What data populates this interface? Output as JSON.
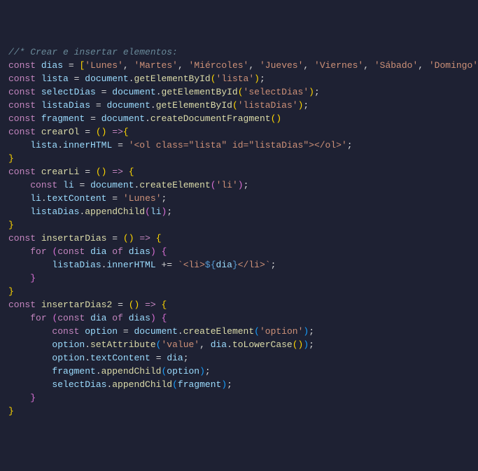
{
  "code": {
    "lines": [
      {
        "indent": 0,
        "t": [
          {
            "c": "comment",
            "v": "//* Crear e insertar elementos:"
          }
        ]
      },
      {
        "indent": 0,
        "t": [
          {
            "c": "kw",
            "v": "const"
          },
          {
            "c": "punct",
            "v": " "
          },
          {
            "c": "const-name",
            "v": "dias"
          },
          {
            "c": "punct",
            "v": " "
          },
          {
            "c": "op",
            "v": "="
          },
          {
            "c": "punct",
            "v": " "
          },
          {
            "c": "brace",
            "v": "["
          },
          {
            "c": "string",
            "v": "'Lunes'"
          },
          {
            "c": "punct",
            "v": ", "
          },
          {
            "c": "string",
            "v": "'Martes'"
          },
          {
            "c": "punct",
            "v": ", "
          },
          {
            "c": "string",
            "v": "'Miércoles'"
          },
          {
            "c": "punct",
            "v": ", "
          },
          {
            "c": "string",
            "v": "'Jueves'"
          },
          {
            "c": "punct",
            "v": ", "
          },
          {
            "c": "string",
            "v": "'Viernes'"
          },
          {
            "c": "punct",
            "v": ", "
          },
          {
            "c": "string",
            "v": "'Sábado'"
          },
          {
            "c": "punct",
            "v": ", "
          },
          {
            "c": "string",
            "v": "'Domingo'"
          },
          {
            "c": "brace",
            "v": "]"
          },
          {
            "c": "punct",
            "v": ";"
          }
        ]
      },
      {
        "indent": 0,
        "t": [
          {
            "c": "kw",
            "v": "const"
          },
          {
            "c": "punct",
            "v": " "
          },
          {
            "c": "const-name",
            "v": "lista"
          },
          {
            "c": "punct",
            "v": " "
          },
          {
            "c": "op",
            "v": "="
          },
          {
            "c": "punct",
            "v": " "
          },
          {
            "c": "obj",
            "v": "document"
          },
          {
            "c": "punct",
            "v": "."
          },
          {
            "c": "method",
            "v": "getElementById"
          },
          {
            "c": "brace",
            "v": "("
          },
          {
            "c": "string",
            "v": "'lista'"
          },
          {
            "c": "brace",
            "v": ")"
          },
          {
            "c": "punct",
            "v": ";"
          }
        ]
      },
      {
        "indent": 0,
        "t": [
          {
            "c": "kw",
            "v": "const"
          },
          {
            "c": "punct",
            "v": " "
          },
          {
            "c": "const-name",
            "v": "selectDias"
          },
          {
            "c": "punct",
            "v": " "
          },
          {
            "c": "op",
            "v": "="
          },
          {
            "c": "punct",
            "v": " "
          },
          {
            "c": "obj",
            "v": "document"
          },
          {
            "c": "punct",
            "v": "."
          },
          {
            "c": "method",
            "v": "getElementById"
          },
          {
            "c": "brace",
            "v": "("
          },
          {
            "c": "string",
            "v": "'selectDias'"
          },
          {
            "c": "brace",
            "v": ")"
          },
          {
            "c": "punct",
            "v": ";"
          }
        ]
      },
      {
        "indent": 0,
        "t": [
          {
            "c": "kw",
            "v": "const"
          },
          {
            "c": "punct",
            "v": " "
          },
          {
            "c": "const-name",
            "v": "listaDias"
          },
          {
            "c": "punct",
            "v": " "
          },
          {
            "c": "op",
            "v": "="
          },
          {
            "c": "punct",
            "v": " "
          },
          {
            "c": "obj",
            "v": "document"
          },
          {
            "c": "punct",
            "v": "."
          },
          {
            "c": "method",
            "v": "getElementById"
          },
          {
            "c": "brace",
            "v": "("
          },
          {
            "c": "string",
            "v": "'listaDias'"
          },
          {
            "c": "brace",
            "v": ")"
          },
          {
            "c": "punct",
            "v": ";"
          }
        ]
      },
      {
        "indent": 0,
        "t": [
          {
            "c": "kw",
            "v": "const"
          },
          {
            "c": "punct",
            "v": " "
          },
          {
            "c": "const-name",
            "v": "fragment"
          },
          {
            "c": "punct",
            "v": " "
          },
          {
            "c": "op",
            "v": "="
          },
          {
            "c": "punct",
            "v": " "
          },
          {
            "c": "obj",
            "v": "document"
          },
          {
            "c": "punct",
            "v": "."
          },
          {
            "c": "method",
            "v": "createDocumentFragment"
          },
          {
            "c": "brace",
            "v": "()"
          }
        ]
      },
      {
        "indent": 0,
        "t": []
      },
      {
        "indent": 0,
        "t": [
          {
            "c": "kw",
            "v": "const"
          },
          {
            "c": "punct",
            "v": " "
          },
          {
            "c": "func-name",
            "v": "crearOl"
          },
          {
            "c": "punct",
            "v": " "
          },
          {
            "c": "op",
            "v": "="
          },
          {
            "c": "punct",
            "v": " "
          },
          {
            "c": "brace",
            "v": "()"
          },
          {
            "c": "punct",
            "v": " "
          },
          {
            "c": "kw",
            "v": "=>"
          },
          {
            "c": "brace",
            "v": "{"
          }
        ]
      },
      {
        "indent": 1,
        "t": [
          {
            "c": "obj",
            "v": "lista"
          },
          {
            "c": "punct",
            "v": "."
          },
          {
            "c": "prop",
            "v": "innerHTML"
          },
          {
            "c": "punct",
            "v": " "
          },
          {
            "c": "op",
            "v": "="
          },
          {
            "c": "punct",
            "v": " "
          },
          {
            "c": "string",
            "v": "'<ol class=\"lista\" id=\"listaDias\"></ol>'"
          },
          {
            "c": "punct",
            "v": ";"
          }
        ]
      },
      {
        "indent": 0,
        "t": [
          {
            "c": "brace",
            "v": "}"
          }
        ]
      },
      {
        "indent": 0,
        "t": []
      },
      {
        "indent": 0,
        "t": [
          {
            "c": "kw",
            "v": "const"
          },
          {
            "c": "punct",
            "v": " "
          },
          {
            "c": "func-name",
            "v": "crearLi"
          },
          {
            "c": "punct",
            "v": " "
          },
          {
            "c": "op",
            "v": "="
          },
          {
            "c": "punct",
            "v": " "
          },
          {
            "c": "brace",
            "v": "()"
          },
          {
            "c": "punct",
            "v": " "
          },
          {
            "c": "kw",
            "v": "=>"
          },
          {
            "c": "punct",
            "v": " "
          },
          {
            "c": "brace",
            "v": "{"
          }
        ]
      },
      {
        "indent": 1,
        "t": [
          {
            "c": "kw",
            "v": "const"
          },
          {
            "c": "punct",
            "v": " "
          },
          {
            "c": "const-name",
            "v": "li"
          },
          {
            "c": "punct",
            "v": " "
          },
          {
            "c": "op",
            "v": "="
          },
          {
            "c": "punct",
            "v": " "
          },
          {
            "c": "obj",
            "v": "document"
          },
          {
            "c": "punct",
            "v": "."
          },
          {
            "c": "method",
            "v": "createElement"
          },
          {
            "c": "brace2",
            "v": "("
          },
          {
            "c": "string",
            "v": "'li'"
          },
          {
            "c": "brace2",
            "v": ")"
          },
          {
            "c": "punct",
            "v": ";"
          }
        ]
      },
      {
        "indent": 1,
        "t": [
          {
            "c": "obj",
            "v": "li"
          },
          {
            "c": "punct",
            "v": "."
          },
          {
            "c": "prop",
            "v": "textContent"
          },
          {
            "c": "punct",
            "v": " "
          },
          {
            "c": "op",
            "v": "="
          },
          {
            "c": "punct",
            "v": " "
          },
          {
            "c": "string",
            "v": "'Lunes'"
          },
          {
            "c": "punct",
            "v": ";"
          }
        ]
      },
      {
        "indent": 1,
        "t": [
          {
            "c": "obj",
            "v": "listaDias"
          },
          {
            "c": "punct",
            "v": "."
          },
          {
            "c": "method",
            "v": "appendChild"
          },
          {
            "c": "brace2",
            "v": "("
          },
          {
            "c": "obj",
            "v": "li"
          },
          {
            "c": "brace2",
            "v": ")"
          },
          {
            "c": "punct",
            "v": ";"
          }
        ]
      },
      {
        "indent": 0,
        "t": [
          {
            "c": "brace",
            "v": "}"
          }
        ]
      },
      {
        "indent": 0,
        "t": []
      },
      {
        "indent": 0,
        "t": [
          {
            "c": "kw",
            "v": "const"
          },
          {
            "c": "punct",
            "v": " "
          },
          {
            "c": "func-name",
            "v": "insertarDias"
          },
          {
            "c": "punct",
            "v": " "
          },
          {
            "c": "op",
            "v": "="
          },
          {
            "c": "punct",
            "v": " "
          },
          {
            "c": "brace",
            "v": "()"
          },
          {
            "c": "punct",
            "v": " "
          },
          {
            "c": "kw",
            "v": "=>"
          },
          {
            "c": "punct",
            "v": " "
          },
          {
            "c": "brace",
            "v": "{"
          }
        ]
      },
      {
        "indent": 1,
        "t": [
          {
            "c": "kw",
            "v": "for"
          },
          {
            "c": "punct",
            "v": " "
          },
          {
            "c": "brace2",
            "v": "("
          },
          {
            "c": "kw",
            "v": "const"
          },
          {
            "c": "punct",
            "v": " "
          },
          {
            "c": "const-name",
            "v": "dia"
          },
          {
            "c": "punct",
            "v": " "
          },
          {
            "c": "kw",
            "v": "of"
          },
          {
            "c": "punct",
            "v": " "
          },
          {
            "c": "obj",
            "v": "dias"
          },
          {
            "c": "brace2",
            "v": ")"
          },
          {
            "c": "punct",
            "v": " "
          },
          {
            "c": "brace2",
            "v": "{"
          }
        ]
      },
      {
        "indent": 2,
        "t": [
          {
            "c": "obj",
            "v": "listaDias"
          },
          {
            "c": "punct",
            "v": "."
          },
          {
            "c": "prop",
            "v": "innerHTML"
          },
          {
            "c": "punct",
            "v": " "
          },
          {
            "c": "op",
            "v": "+="
          },
          {
            "c": "punct",
            "v": " "
          },
          {
            "c": "string",
            "v": "`<li>"
          },
          {
            "c": "tpl-expr",
            "v": "${"
          },
          {
            "c": "obj",
            "v": "dia"
          },
          {
            "c": "tpl-expr",
            "v": "}"
          },
          {
            "c": "string",
            "v": "</li>`"
          },
          {
            "c": "punct",
            "v": ";"
          }
        ]
      },
      {
        "indent": 1,
        "t": [
          {
            "c": "brace2",
            "v": "}"
          }
        ]
      },
      {
        "indent": 0,
        "t": [
          {
            "c": "brace",
            "v": "}"
          }
        ]
      },
      {
        "indent": 0,
        "t": []
      },
      {
        "indent": 0,
        "t": [
          {
            "c": "kw",
            "v": "const"
          },
          {
            "c": "punct",
            "v": " "
          },
          {
            "c": "func-name",
            "v": "insertarDias2"
          },
          {
            "c": "punct",
            "v": " "
          },
          {
            "c": "op",
            "v": "="
          },
          {
            "c": "punct",
            "v": " "
          },
          {
            "c": "brace",
            "v": "()"
          },
          {
            "c": "punct",
            "v": " "
          },
          {
            "c": "kw",
            "v": "=>"
          },
          {
            "c": "punct",
            "v": " "
          },
          {
            "c": "brace",
            "v": "{"
          }
        ]
      },
      {
        "indent": 1,
        "t": [
          {
            "c": "kw",
            "v": "for"
          },
          {
            "c": "punct",
            "v": " "
          },
          {
            "c": "brace2",
            "v": "("
          },
          {
            "c": "kw",
            "v": "const"
          },
          {
            "c": "punct",
            "v": " "
          },
          {
            "c": "const-name",
            "v": "dia"
          },
          {
            "c": "punct",
            "v": " "
          },
          {
            "c": "kw",
            "v": "of"
          },
          {
            "c": "punct",
            "v": " "
          },
          {
            "c": "obj",
            "v": "dias"
          },
          {
            "c": "brace2",
            "v": ")"
          },
          {
            "c": "punct",
            "v": " "
          },
          {
            "c": "brace2",
            "v": "{"
          }
        ]
      },
      {
        "indent": 2,
        "t": [
          {
            "c": "kw",
            "v": "const"
          },
          {
            "c": "punct",
            "v": " "
          },
          {
            "c": "const-name",
            "v": "option"
          },
          {
            "c": "punct",
            "v": " "
          },
          {
            "c": "op",
            "v": "="
          },
          {
            "c": "punct",
            "v": " "
          },
          {
            "c": "obj",
            "v": "document"
          },
          {
            "c": "punct",
            "v": "."
          },
          {
            "c": "method",
            "v": "createElement"
          },
          {
            "c": "brace3",
            "v": "("
          },
          {
            "c": "string",
            "v": "'option'"
          },
          {
            "c": "brace3",
            "v": ")"
          },
          {
            "c": "punct",
            "v": ";"
          }
        ]
      },
      {
        "indent": 2,
        "t": [
          {
            "c": "obj",
            "v": "option"
          },
          {
            "c": "punct",
            "v": "."
          },
          {
            "c": "method",
            "v": "setAttribute"
          },
          {
            "c": "brace3",
            "v": "("
          },
          {
            "c": "string",
            "v": "'value'"
          },
          {
            "c": "punct",
            "v": ", "
          },
          {
            "c": "obj",
            "v": "dia"
          },
          {
            "c": "punct",
            "v": "."
          },
          {
            "c": "method",
            "v": "toLowerCase"
          },
          {
            "c": "brace",
            "v": "()"
          },
          {
            "c": "brace3",
            "v": ")"
          },
          {
            "c": "punct",
            "v": ";"
          }
        ]
      },
      {
        "indent": 2,
        "t": [
          {
            "c": "obj",
            "v": "option"
          },
          {
            "c": "punct",
            "v": "."
          },
          {
            "c": "prop",
            "v": "textContent"
          },
          {
            "c": "punct",
            "v": " "
          },
          {
            "c": "op",
            "v": "="
          },
          {
            "c": "punct",
            "v": " "
          },
          {
            "c": "obj",
            "v": "dia"
          },
          {
            "c": "punct",
            "v": ";"
          }
        ]
      },
      {
        "indent": 2,
        "t": [
          {
            "c": "obj",
            "v": "fragment"
          },
          {
            "c": "punct",
            "v": "."
          },
          {
            "c": "method",
            "v": "appendChild"
          },
          {
            "c": "brace3",
            "v": "("
          },
          {
            "c": "obj",
            "v": "option"
          },
          {
            "c": "brace3",
            "v": ")"
          },
          {
            "c": "punct",
            "v": ";"
          }
        ]
      },
      {
        "indent": 2,
        "t": [
          {
            "c": "obj",
            "v": "selectDias"
          },
          {
            "c": "punct",
            "v": "."
          },
          {
            "c": "method",
            "v": "appendChild"
          },
          {
            "c": "brace3",
            "v": "("
          },
          {
            "c": "obj",
            "v": "fragment"
          },
          {
            "c": "brace3",
            "v": ")"
          },
          {
            "c": "punct",
            "v": ";"
          }
        ]
      },
      {
        "indent": 1,
        "t": [
          {
            "c": "brace2",
            "v": "}"
          }
        ]
      },
      {
        "indent": 0,
        "t": [
          {
            "c": "brace",
            "v": "}"
          }
        ]
      }
    ]
  }
}
